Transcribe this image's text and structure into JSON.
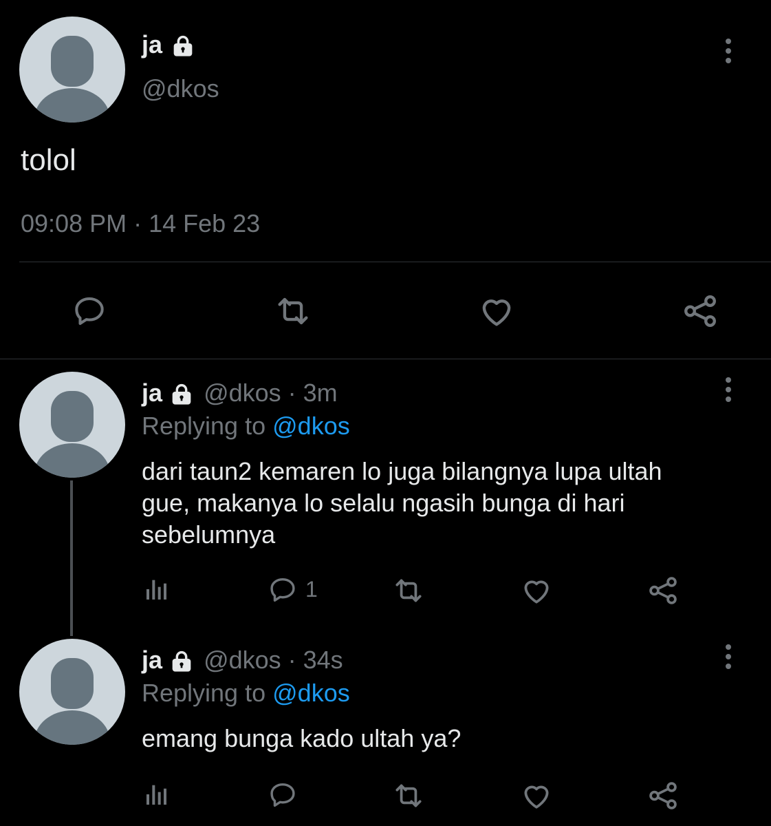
{
  "main_tweet": {
    "display_name": "ja",
    "handle": "@dkos",
    "text": "tolol",
    "timestamp": "09:08 PM · 14 Feb 23",
    "actions": [
      "reply-icon",
      "retweet-icon",
      "like-icon",
      "share-icon"
    ]
  },
  "replies": [
    {
      "display_name": "ja",
      "handle_time": "@dkos · 3m",
      "replying_label": "Replying to",
      "replying_handle": "@dkos",
      "text_lines": [
        "dari taun2 kemaren lo juga bilangnya lupa ultah",
        "gue, makanya lo selalu ngasih bunga di hari",
        "sebelumnya"
      ],
      "reply_count": "1"
    },
    {
      "display_name": "ja",
      "handle_time": "@dkos · 34s",
      "replying_label": "Replying to",
      "replying_handle": "@dkos",
      "text_lines": [
        "emang bunga kado ultah ya?"
      ],
      "reply_count": ""
    }
  ],
  "colors": {
    "background": "#000000",
    "text": "#e7e9ea",
    "muted": "#71767b",
    "link": "#1d9bf0",
    "divider": "#2f3336",
    "avatar_bg": "#cdd6dc",
    "avatar_fg": "#66757f"
  }
}
